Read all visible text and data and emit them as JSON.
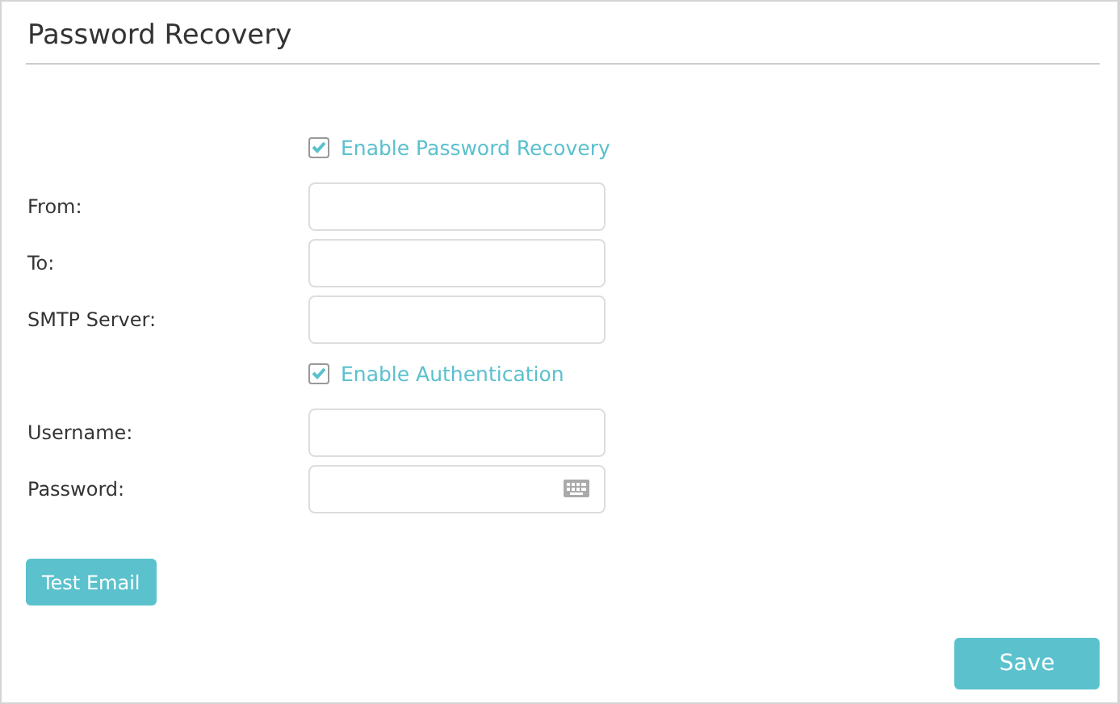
{
  "title": "Password Recovery",
  "rows": [
    {
      "kind": "checkbox",
      "label": "Enable Password Recovery",
      "checked": true
    },
    {
      "kind": "text",
      "label": "From:"
    },
    {
      "kind": "text",
      "label": "To:"
    },
    {
      "kind": "text",
      "label": "SMTP Server:"
    },
    {
      "kind": "checkbox",
      "label": "Enable Authentication",
      "checked": true
    },
    {
      "kind": "text",
      "label": "Username:"
    },
    {
      "kind": "password",
      "label": "Password:"
    }
  ],
  "test_button": "Test Email",
  "save_button": "Save"
}
